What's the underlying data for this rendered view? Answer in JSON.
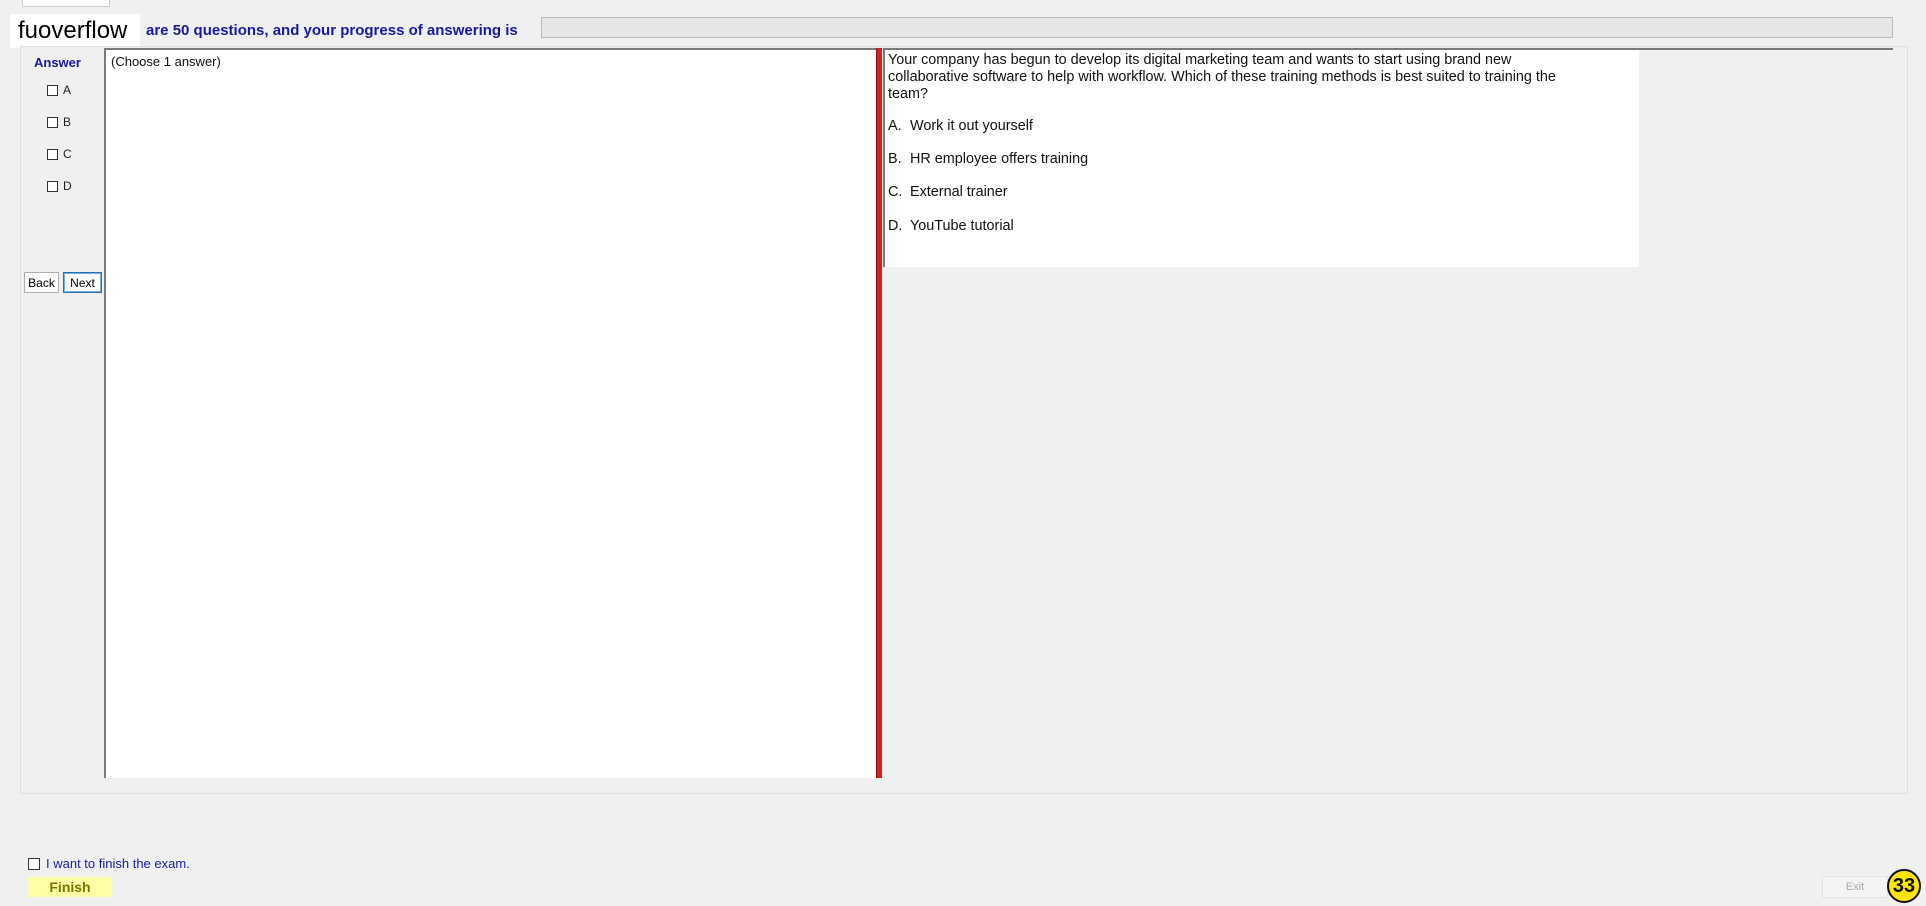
{
  "header": {
    "brand": "fuoverflow",
    "progress_text": "are 50 questions, and your progress of answering is",
    "progress_fraction": 0
  },
  "answer_panel": {
    "title": "Answer",
    "options": [
      "A",
      "B",
      "C",
      "D"
    ],
    "back_label": "Back",
    "next_label": "Next"
  },
  "notes": {
    "instruction": "(Choose 1 answer)"
  },
  "question": {
    "text": "Your company has begun to develop its digital marketing team and wants to start using brand new collaborative software to help with workflow. Which of these training methods is best suited to training the team?",
    "choices": [
      {
        "letter": "A.",
        "text": "Work it out yourself"
      },
      {
        "letter": "B.",
        "text": "HR employee offers training"
      },
      {
        "letter": "C.",
        "text": "External trainer"
      },
      {
        "letter": "D.",
        "text": "YouTube tutorial"
      }
    ]
  },
  "footer": {
    "finish_check_label": "I want to finish the exam.",
    "finish_label": "Finish",
    "exit_label": "Exit",
    "badge": "33"
  },
  "colors": {
    "accent_blue": "#1a1aa0",
    "splitter_red": "#d81e1e",
    "finish_yellow": "#ffffa8",
    "badge_yellow": "#ffe600"
  }
}
